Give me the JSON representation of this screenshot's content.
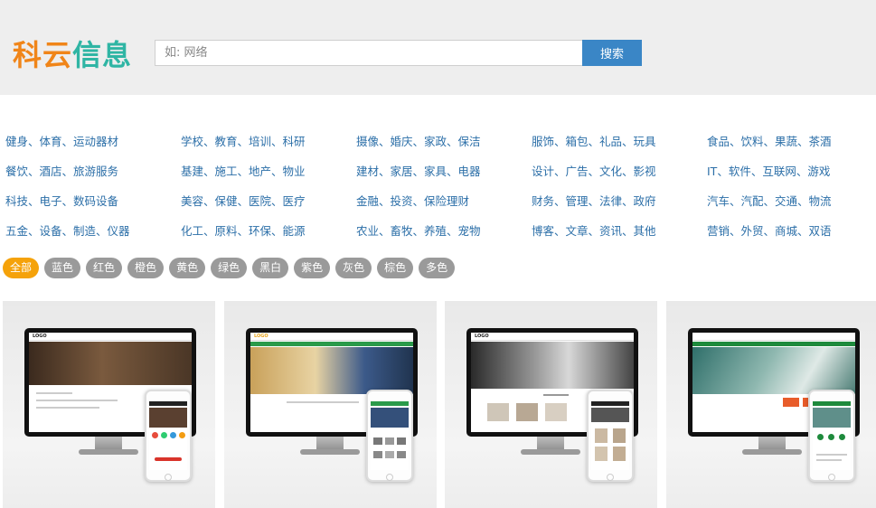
{
  "header": {
    "logo": {
      "part1": "科云",
      "part2": "信息"
    },
    "search": {
      "placeholder": "如: 网络",
      "button_label": "搜索"
    }
  },
  "categories": [
    [
      "健身、体育、运动器材",
      "学校、教育、培训、科研",
      "摄像、婚庆、家政、保洁",
      "服饰、箱包、礼品、玩具",
      "食品、饮料、果蔬、茶酒"
    ],
    [
      "餐饮、酒店、旅游服务",
      "基建、施工、地产、物业",
      "建材、家居、家具、电器",
      "设计、广告、文化、影视",
      "IT、软件、互联网、游戏"
    ],
    [
      "科技、电子、数码设备",
      "美容、保健、医院、医疗",
      "金融、投资、保险理财",
      "财务、管理、法律、政府",
      "汽车、汽配、交通、物流"
    ],
    [
      "五金、设备、制造、仪器",
      "化工、原料、环保、能源",
      "农业、畜牧、养殖、宠物",
      "博客、文章、资讯、其他",
      "营销、外贸、商城、双语"
    ]
  ],
  "colors": {
    "active_index": 0,
    "items": [
      "全部",
      "蓝色",
      "红色",
      "橙色",
      "黄色",
      "绿色",
      "黑白",
      "紫色",
      "灰色",
      "棕色",
      "多色"
    ]
  },
  "templates": [
    {
      "screen_logo": "LOGO",
      "caption": "",
      "accent": "#6b4a2e"
    },
    {
      "screen_logo": "LOGO",
      "caption": "",
      "accent": "#2a9a4a"
    },
    {
      "screen_logo": "LOGO",
      "caption": "",
      "accent": "#555555"
    },
    {
      "screen_logo": "",
      "caption": "",
      "accent": "#1e8a3c"
    }
  ],
  "theme": {
    "header_bg": "#eeeeee",
    "link_color": "#2c6fa8",
    "search_button": "#3a86c6",
    "pill_active": "#f5a20a",
    "pill_default": "#9a9a9a",
    "logo_orange": "#f08519",
    "logo_teal": "#2fb5a4"
  }
}
